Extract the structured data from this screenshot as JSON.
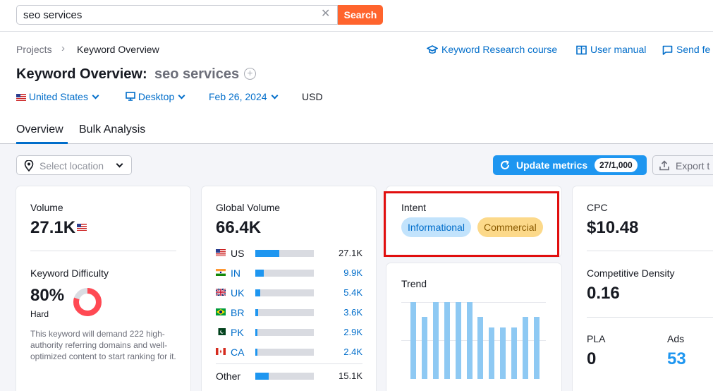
{
  "search": {
    "value": "seo services",
    "clear_icon": "close-icon",
    "button_label": "Search"
  },
  "breadcrumb": {
    "root": "Projects",
    "current": "Keyword Overview",
    "separator_icon": "chevron-right-icon"
  },
  "header_links": [
    {
      "label": "Keyword Research course",
      "icon": "graduation-cap-icon"
    },
    {
      "label": "User manual",
      "icon": "book-icon"
    },
    {
      "label": "Send fe",
      "icon": "message-icon"
    }
  ],
  "title": {
    "prefix": "Keyword Overview:",
    "keyword": "seo services"
  },
  "filters": {
    "country": "United States",
    "device": "Desktop",
    "date": "Feb 26, 2024",
    "currency": "USD"
  },
  "tabs": [
    {
      "label": "Overview",
      "active": true
    },
    {
      "label": "Bulk Analysis",
      "active": false
    }
  ],
  "toolbar": {
    "location_placeholder": "Select location",
    "update_label": "Update metrics",
    "update_count": "27/1,000",
    "export_label": "Export t"
  },
  "volume_card": {
    "volume_label": "Volume",
    "volume_value": "27.1K",
    "kd_label": "Keyword Difficulty",
    "kd_value": "80%",
    "kd_percent": 80,
    "kd_level": "Hard",
    "kd_description": "This keyword will demand 222 high-authority referring domains and well-optimized content to start ranking for it."
  },
  "global_volume_card": {
    "label": "Global Volume",
    "value": "66.4K",
    "countries": [
      {
        "code": "US",
        "value": "27.1K",
        "share": 0.41,
        "link": false
      },
      {
        "code": "IN",
        "value": "9.9K",
        "share": 0.15,
        "link": true
      },
      {
        "code": "UK",
        "value": "5.4K",
        "share": 0.08,
        "link": true
      },
      {
        "code": "BR",
        "value": "3.6K",
        "share": 0.05,
        "link": true
      },
      {
        "code": "PK",
        "value": "2.9K",
        "share": 0.04,
        "link": true
      },
      {
        "code": "CA",
        "value": "2.4K",
        "share": 0.04,
        "link": true
      }
    ],
    "other": {
      "label": "Other",
      "value": "15.1K",
      "share": 0.23
    }
  },
  "intent_card": {
    "label": "Intent",
    "chips": [
      "Informational",
      "Commercial"
    ]
  },
  "trend_card": {
    "label": "Trend",
    "values": [
      1.0,
      0.81,
      1.0,
      1.0,
      1.0,
      1.0,
      0.81,
      0.67,
      0.67,
      0.67,
      0.81,
      0.81
    ]
  },
  "cpc_card": {
    "cpc_label": "CPC",
    "cpc_value": "$10.48",
    "density_label": "Competitive Density",
    "density_value": "0.16",
    "pla_label": "PLA",
    "pla_value": "0",
    "ads_label": "Ads",
    "ads_value": "53"
  },
  "colors": {
    "accent": "#1e96f0",
    "link": "#006dca",
    "search_button": "#ff642d",
    "difficulty": "#ff4953",
    "highlight": "#e10e0e"
  }
}
